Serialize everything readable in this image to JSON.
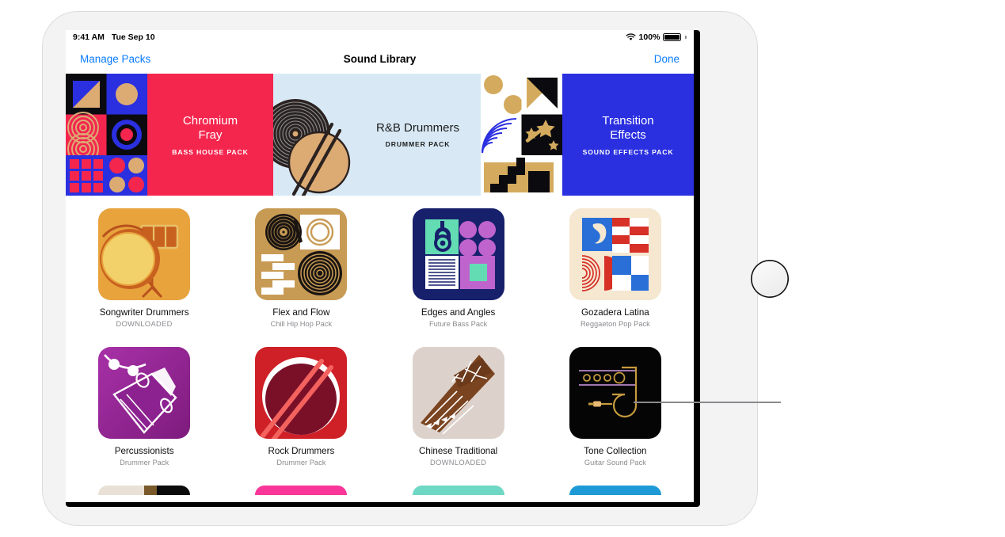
{
  "device": {
    "name": "iPad"
  },
  "statusbar": {
    "time": "9:41 AM",
    "date": "Tue Sep 10",
    "wifi_icon": "wifi-icon",
    "battery_percent": "100%",
    "battery_icon": "battery-full-icon"
  },
  "navbar": {
    "left_button": "Manage Packs",
    "title": "Sound Library",
    "right_button": "Done"
  },
  "banners": [
    {
      "title": "Chromium\nFray",
      "title_line1": "Chromium",
      "title_line2": "Fray",
      "subtitle": "BASS HOUSE PACK",
      "bg_color": "#f4264e",
      "text_color": "#ffffff"
    },
    {
      "title": "R&B Drummers",
      "title_line1": "R&B Drummers",
      "title_line2": "",
      "subtitle": "DRUMMER PACK",
      "bg_color": "#d8e9f5",
      "text_color": "#1b1b1b"
    },
    {
      "title": "Transition\nEffects",
      "title_line1": "Transition",
      "title_line2": "Effects",
      "subtitle": "SOUND EFFECTS PACK",
      "bg_color": "#2a2fe0",
      "text_color": "#ffffff"
    }
  ],
  "packs": [
    {
      "name": "Songwriter Drummers",
      "subtitle": "DOWNLOADED",
      "status": "downloaded",
      "art_color": "#e8a33d"
    },
    {
      "name": "Flex and Flow",
      "subtitle": "Chill Hip Hop Pack",
      "status": "available",
      "art_color": "#c89b54"
    },
    {
      "name": "Edges and Angles",
      "subtitle": "Future Bass Pack",
      "status": "available",
      "art_color": "#17206b"
    },
    {
      "name": "Gozadera Latina",
      "subtitle": "Reggaeton Pop Pack",
      "status": "available",
      "art_color": "#f5e7d0"
    },
    {
      "name": "Percussionists",
      "subtitle": "Drummer Pack",
      "status": "available",
      "art_color": "#9b2a9b"
    },
    {
      "name": "Rock Drummers",
      "subtitle": "Drummer Pack",
      "status": "available",
      "art_color": "#cf2027"
    },
    {
      "name": "Chinese Traditional",
      "subtitle": "DOWNLOADED",
      "status": "downloaded",
      "art_color": "#ddd2cb"
    },
    {
      "name": "Tone Collection",
      "subtitle": "Guitar Sound Pack",
      "status": "available",
      "art_color": "#050505"
    }
  ],
  "partial_row_colors": [
    "#e9e1d6",
    "#f9379a",
    "#6fd8c4",
    "#1e9bd7"
  ],
  "callout": {
    "label": "callout-line"
  },
  "colors": {
    "accent_blue": "#0a7cff",
    "text_primary": "#0d0d0d",
    "text_secondary": "#8b8b90",
    "screen_bg": "#ffffff"
  }
}
